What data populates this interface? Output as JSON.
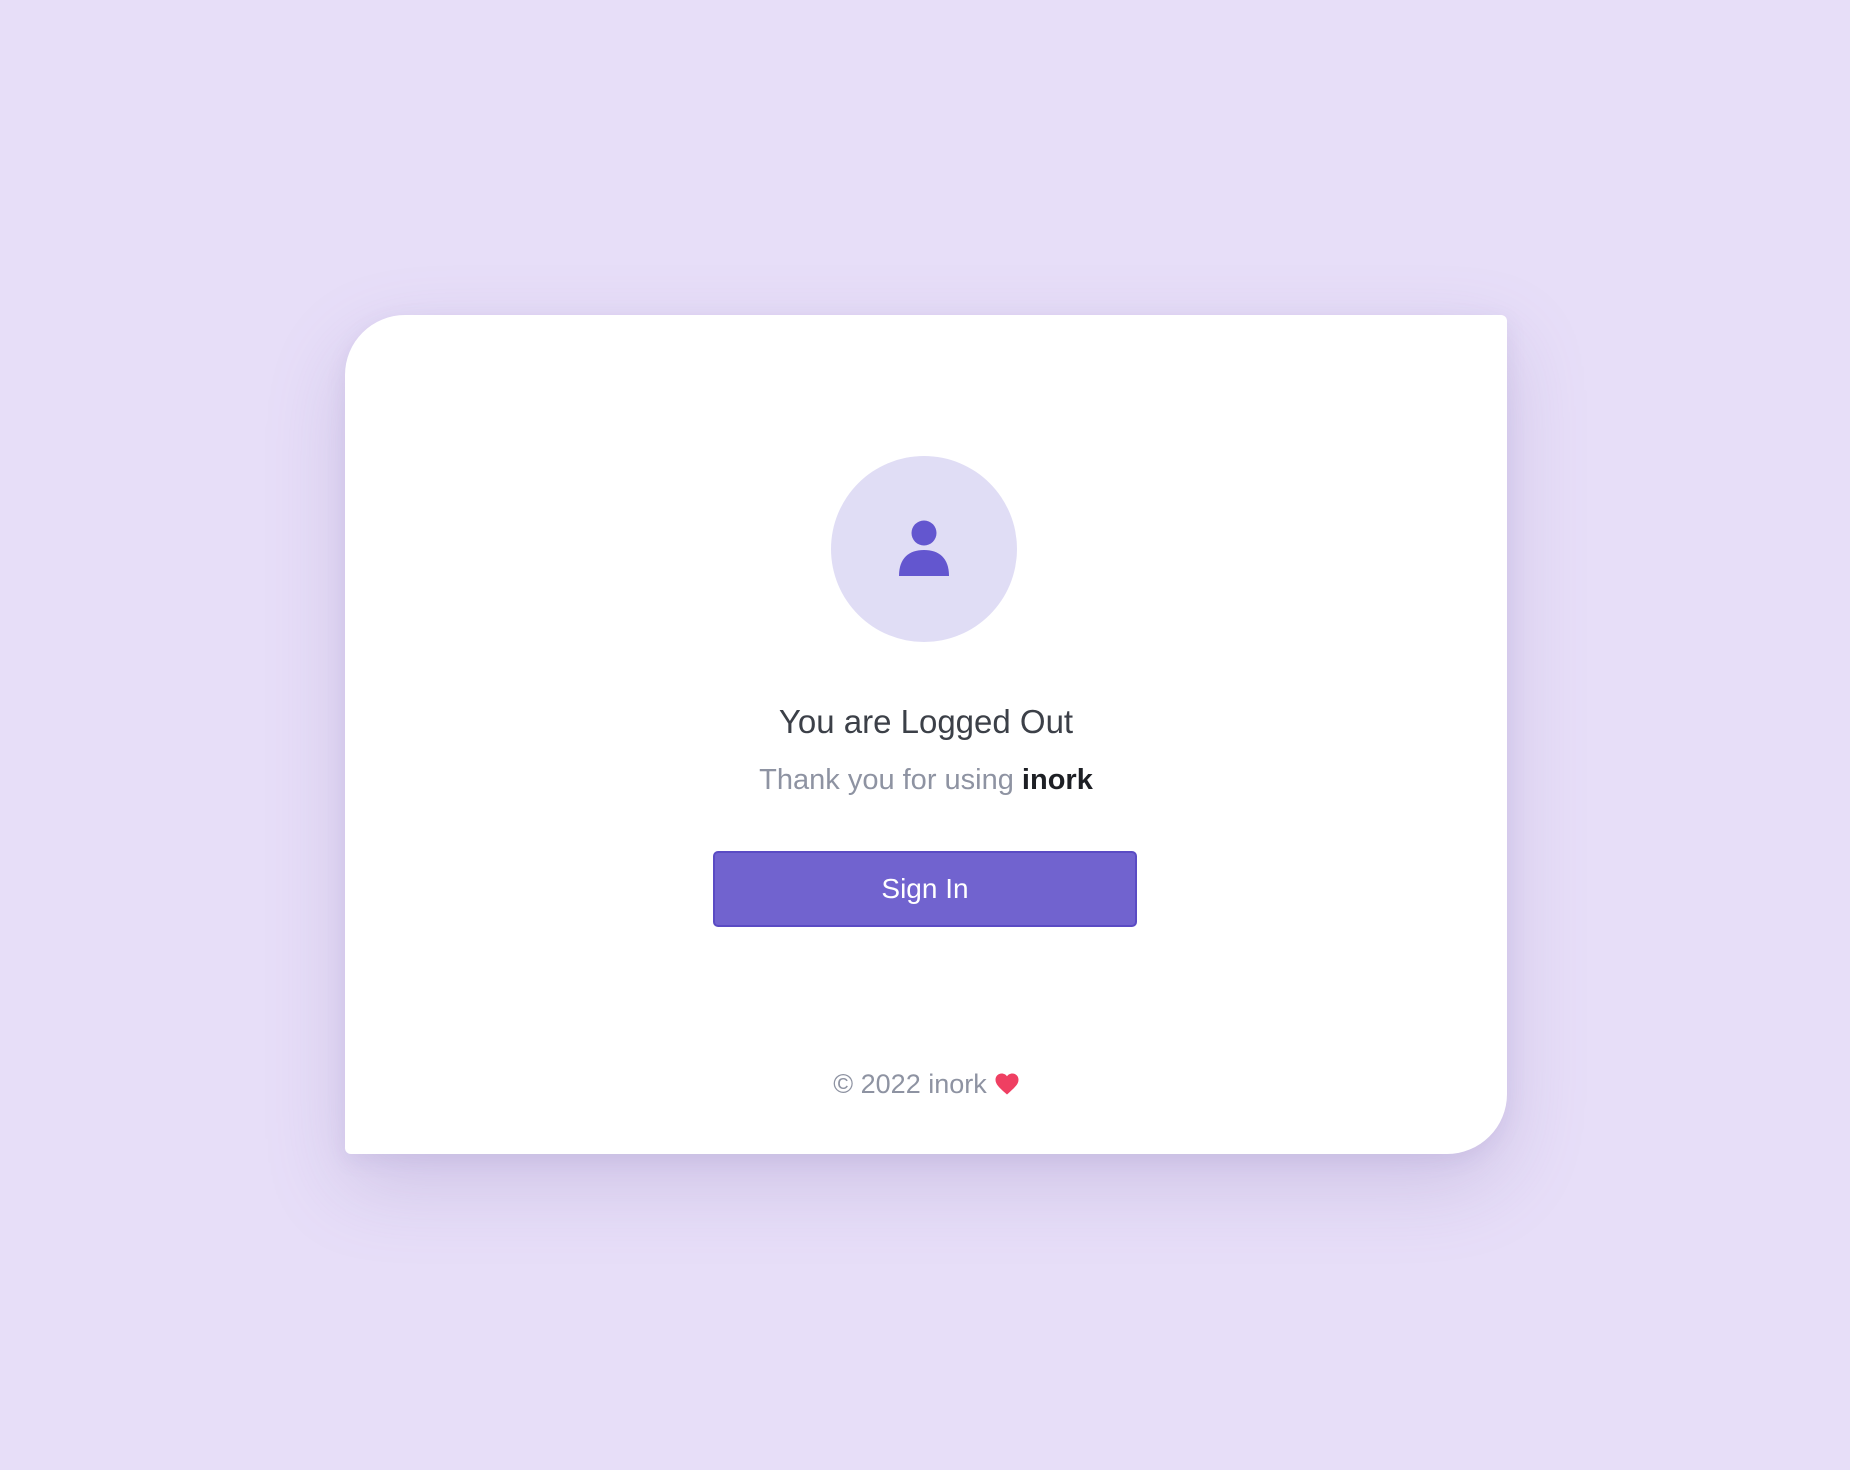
{
  "logout": {
    "avatar_icon": "user-icon",
    "title": "You are Logged Out",
    "subtitle_prefix": "Thank you for using",
    "brand": "inork",
    "sign_in_label": "Sign In",
    "footer_text": "© 2022 inork",
    "heart_icon": "heart-icon"
  },
  "colors": {
    "background": "#e7def8",
    "card": "#ffffff",
    "accent": "#7163cf",
    "avatar_bg": "#e0ddf5",
    "icon": "#6356cf",
    "heart": "#ef3f62"
  }
}
